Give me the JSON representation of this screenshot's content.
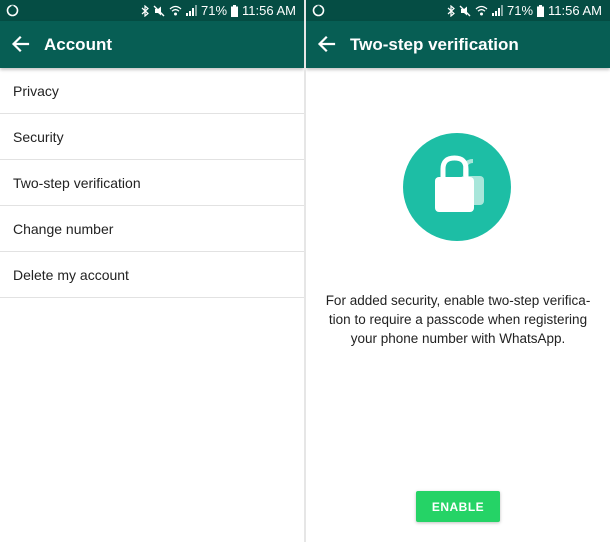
{
  "status_bar": {
    "battery": "71%",
    "time": "11:56 AM",
    "icons": [
      "app-notification-icon",
      "bluetooth-icon",
      "mute-icon",
      "wifi-icon",
      "signal-icon",
      "battery-icon"
    ]
  },
  "account_screen": {
    "title": "Account",
    "items": [
      {
        "label": "Privacy"
      },
      {
        "label": "Security"
      },
      {
        "label": "Two-step verification"
      },
      {
        "label": "Change number"
      },
      {
        "label": "Delete my account"
      }
    ]
  },
  "two_step_screen": {
    "title": "Two-step verification",
    "description_lines": [
      "For added security, enable two-step verifica-",
      "tion to require a passcode when registering",
      "your phone number with WhatsApp."
    ],
    "enable_label": "ENABLE"
  },
  "colors": {
    "status_bar": "#054d44",
    "toolbar": "#075e54",
    "lock_circle": "#1dbea5",
    "enable_button": "#25d366"
  }
}
